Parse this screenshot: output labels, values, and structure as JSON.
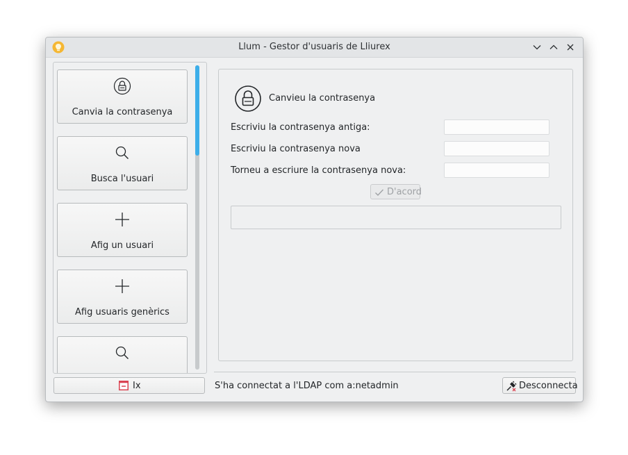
{
  "window": {
    "title": "Llum - Gestor d'usuaris de Lliurex",
    "icon": "lightbulb-icon",
    "accent_color": "#3daee9"
  },
  "sidebar": {
    "items": [
      {
        "label": "Canvia la contrasenya",
        "icon": "lock-icon"
      },
      {
        "label": "Busca l'usuari",
        "icon": "search-icon"
      },
      {
        "label": "Afig un usuari",
        "icon": "plus-icon"
      },
      {
        "label": "Afig usuaris genèrics",
        "icon": "plus-icon"
      },
      {
        "label": "",
        "icon": "search-icon"
      }
    ]
  },
  "panel": {
    "title": "Canvieu la contrasenya",
    "fields": [
      {
        "label": "Escriviu la contrasenya antiga:",
        "value": ""
      },
      {
        "label": "Escriviu la contrasenya nova",
        "value": ""
      },
      {
        "label": "Torneu a escriure la contrasenya nova:",
        "value": ""
      }
    ],
    "ok_label": "D'acord",
    "message": ""
  },
  "footer": {
    "exit_label": "Ix",
    "status": "S'ha connectat a l'LDAP com a:netadmin",
    "disconnect_label": "Desconnecta"
  }
}
